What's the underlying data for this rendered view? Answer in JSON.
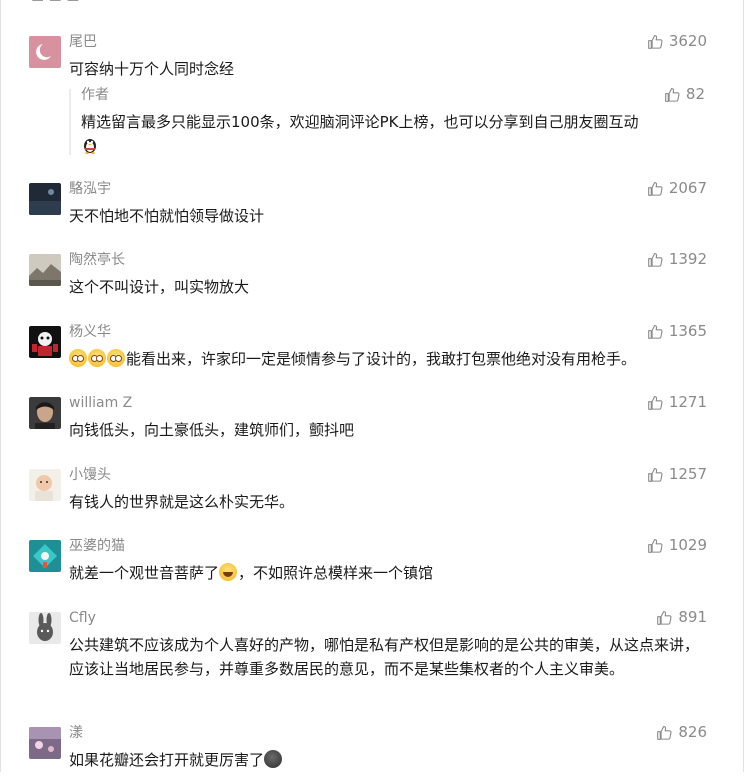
{
  "colors": {
    "meta": "#8a8a8a",
    "text": "#1a1a1a",
    "divider": "#ececec"
  },
  "icons": {
    "like": "thumbs-up-outline-icon"
  },
  "comments": [
    {
      "name": "尾巴",
      "likes": "3620",
      "content": "可容纳十万个人同时念经",
      "avatar": "pink-moon-avatar",
      "reply": {
        "name": "作者",
        "likes": "82",
        "content": "精选留言最多只能显示100条，欢迎脑洞评论PK上榜，也可以分享到自己朋友圈互动",
        "emoji": "qq-penguin-icon"
      }
    },
    {
      "name": "駱泓宇",
      "likes": "2067",
      "content": "天不怕地不怕就怕领导做设计",
      "avatar": "dark-photo-avatar"
    },
    {
      "name": "陶然亭长",
      "likes": "1392",
      "content": "这个不叫设计，叫实物放大",
      "avatar": "landscape-avatar"
    },
    {
      "name": "杨义华",
      "likes": "1365",
      "content": "能看出来，许家印一定是倾情参与了设计的，我敢打包票他绝对没有用枪手。",
      "avatar": "cartoon-avatar",
      "emoji_prefix": [
        "blush-emoji",
        "blush-emoji",
        "blush-emoji"
      ]
    },
    {
      "name": "william Z",
      "likes": "1271",
      "content": "向钱低头，向土豪低头，建筑师们，颤抖吧",
      "avatar": "portrait-avatar"
    },
    {
      "name": "小馒头",
      "likes": "1257",
      "content": "有钱人的世界就是这么朴实无华。",
      "avatar": "baby-avatar"
    },
    {
      "name": "巫婆的猫",
      "likes": "1029",
      "content_before": "就差一个观世音菩萨了",
      "content_after": "，不如照许总模样来一个镇馆",
      "avatar": "teal-game-avatar",
      "inline_emoji": "laughing-emoji"
    },
    {
      "name": "Cfly",
      "likes": "891",
      "content": "公共建筑不应该成为个人喜好的产物，哪怕是私有产权但是影响的是公共的审美，从这点来讲，应该让当地居民参与，并尊重多数居民的意见，而不是某些集权者的个人主义审美。",
      "avatar": "rabbit-avatar"
    },
    {
      "name": "漾",
      "likes": "826",
      "content_before": "如果花瓣还会打开就更厉害了",
      "avatar": "purple-avatar",
      "inline_emoji": "dark-face-emoji"
    }
  ]
}
